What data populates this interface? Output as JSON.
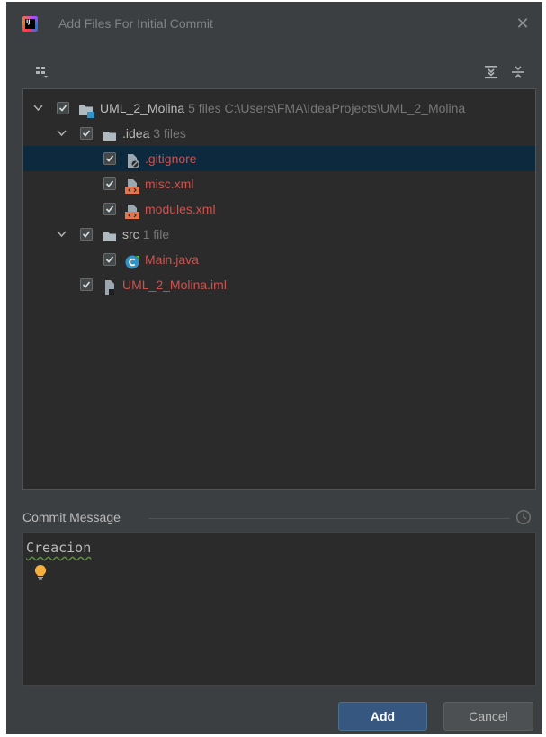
{
  "window": {
    "title": "Add Files For Initial Commit",
    "close_glyph": "✕",
    "app_icon": "intellij-idea-icon"
  },
  "toolbar": {
    "group_by_icon": "group-by-icon",
    "expand_all_icon": "expand-all-icon",
    "collapse_all_icon": "collapse-all-icon"
  },
  "tree": {
    "root": {
      "label": "UML_2_Molina",
      "count": "5 files",
      "path": "C:\\Users\\FMA\\IdeaProjects\\UML_2_Molina"
    },
    "idea_folder": {
      "label": ".idea",
      "count": "3 files"
    },
    "gitignore": {
      "label": ".gitignore"
    },
    "misc": {
      "label": "misc.xml"
    },
    "modules": {
      "label": "modules.xml"
    },
    "src_folder": {
      "label": "src",
      "count": "1 file"
    },
    "main_java": {
      "label": "Main.java"
    },
    "iml": {
      "label": "UML_2_Molina.iml"
    }
  },
  "commit": {
    "label": "Commit Message",
    "message": "Creacion"
  },
  "buttons": {
    "add": "Add",
    "cancel": "Cancel"
  },
  "colors": {
    "dialog_bg": "#3c3f41",
    "panel_bg": "#2b2b2b",
    "selection_bg": "#0d293e",
    "new_file_red": "#c75450",
    "primary_button": "#365880"
  }
}
